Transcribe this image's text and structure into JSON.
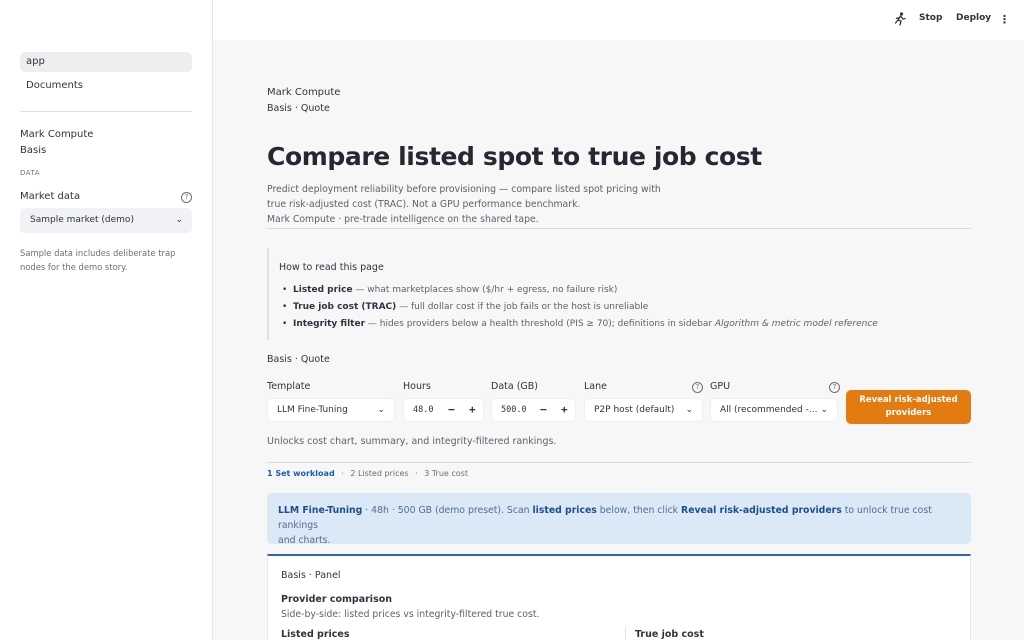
{
  "sidebar": {
    "nav": [
      {
        "label": "app",
        "active": true
      },
      {
        "label": "Documents",
        "active": false
      }
    ],
    "brand_line1": "Mark Compute",
    "brand_line2": "Basis",
    "section_caption": "DATA",
    "market_label": "Market data",
    "market_value": "Sample market (demo)",
    "note": "Sample data includes deliberate trap nodes for the demo story."
  },
  "header": {
    "stop_label": "Stop",
    "deploy_label": "Deploy"
  },
  "main": {
    "breadcrumb_1": "Mark Compute",
    "breadcrumb_2": "Basis · Quote",
    "title": "Compare listed spot to true job cost",
    "desc_1": "Predict deployment reliability before provisioning — compare listed spot pricing with",
    "desc_2": "true risk-adjusted cost (TRAC). Not a GPU performance benchmark.",
    "desc_3": "Mark Compute · pre-trade intelligence on the shared tape.",
    "howto": {
      "title": "How to read this page",
      "b1_bold": "Listed price",
      "b1_rest": " — what marketplaces show ($/hr + egress, no failure risk)",
      "b2_bold": "True job cost (TRAC)",
      "b2_rest": " — full dollar cost if the job fails or the host is unreliable",
      "b3_bold": "Integrity filter",
      "b3_rest": " — hides providers below a health threshold (PIS ≥ 70); definitions in sidebar ",
      "b3_italic": "Algorithm & metric model reference"
    },
    "section_label": "Basis · Quote",
    "form": {
      "template_label": "Template",
      "template_value": "LLM Fine-Tuning",
      "hours_label": "Hours",
      "hours_value": "48.0",
      "data_label": "Data (GB)",
      "data_value": "500.0",
      "lane_label": "Lane",
      "lane_value": "P2P host (default)",
      "gpu_label": "GPU",
      "gpu_value": "All (recommended -...",
      "reveal_line1": "Reveal risk-adjusted",
      "reveal_line2": "providers",
      "minus": "−",
      "plus": "+"
    },
    "unlock_note": "Unlocks cost chart, summary, and integrity-filtered rankings.",
    "steps": {
      "s1": "1 Set workload",
      "s2": "2 Listed prices",
      "s3": "3 True cost",
      "sep": "·"
    },
    "info": {
      "p1_bold": "LLM Fine-Tuning",
      "p2": " · 48h · 500 GB (demo preset). Scan ",
      "p3_bold": "listed prices",
      "p4": " below, then click ",
      "p5_bold": "Reveal risk-adjusted providers",
      "p6": " to unlock true cost rankings",
      "p7": "and charts."
    },
    "panel": {
      "label": "Basis · Panel",
      "title": "Provider comparison",
      "subtitle": "Side-by-side: listed prices vs integrity-filtered true cost.",
      "col_left": "Listed prices",
      "col_right": "True job cost"
    }
  }
}
